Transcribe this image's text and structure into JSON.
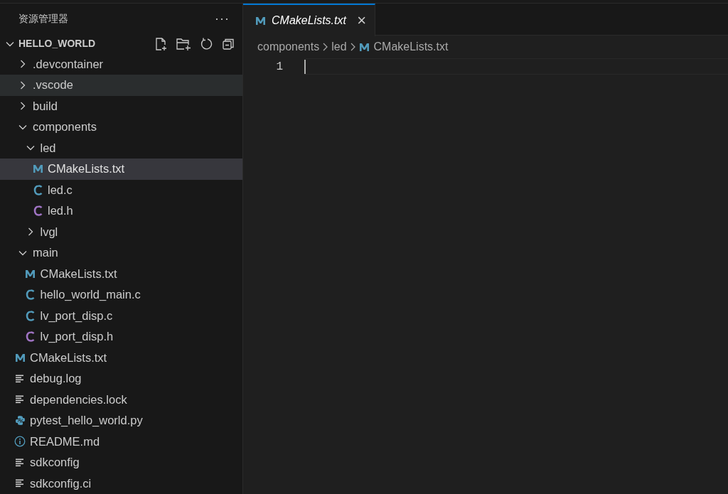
{
  "sidebar": {
    "title": "资源管理器",
    "more": "···",
    "workspace": {
      "label": "HELLO_WORLD",
      "expanded": true
    },
    "items": [
      {
        "label": ".devcontainer",
        "kind": "folder",
        "expanded": false,
        "selected": false,
        "hovered": false
      },
      {
        "label": ".vscode",
        "kind": "folder",
        "expanded": false,
        "selected": false,
        "hovered": true
      },
      {
        "label": "build",
        "kind": "folder",
        "expanded": false,
        "selected": false,
        "hovered": false
      },
      {
        "label": "components",
        "kind": "folder",
        "expanded": true,
        "selected": false,
        "hovered": false,
        "children": [
          {
            "label": "led",
            "kind": "folder",
            "expanded": true,
            "selected": false,
            "hovered": false,
            "children": [
              {
                "label": "CMakeLists.txt",
                "kind": "cmake",
                "selected": true,
                "hovered": false
              },
              {
                "label": "led.c",
                "kind": "c",
                "selected": false,
                "hovered": false
              },
              {
                "label": "led.h",
                "kind": "h",
                "selected": false,
                "hovered": false
              }
            ]
          },
          {
            "label": "lvgl",
            "kind": "folder",
            "expanded": false,
            "selected": false,
            "hovered": false
          }
        ]
      },
      {
        "label": "main",
        "kind": "folder",
        "expanded": true,
        "selected": false,
        "hovered": false,
        "children": [
          {
            "label": "CMakeLists.txt",
            "kind": "cmake",
            "selected": false,
            "hovered": false
          },
          {
            "label": "hello_world_main.c",
            "kind": "c",
            "selected": false,
            "hovered": false
          },
          {
            "label": "lv_port_disp.c",
            "kind": "c",
            "selected": false,
            "hovered": false
          },
          {
            "label": "lv_port_disp.h",
            "kind": "h",
            "selected": false,
            "hovered": false
          }
        ]
      },
      {
        "label": "CMakeLists.txt",
        "kind": "cmake",
        "selected": false,
        "hovered": false
      },
      {
        "label": "debug.log",
        "kind": "text",
        "selected": false,
        "hovered": false
      },
      {
        "label": "dependencies.lock",
        "kind": "text",
        "selected": false,
        "hovered": false
      },
      {
        "label": "pytest_hello_world.py",
        "kind": "python",
        "selected": false,
        "hovered": false
      },
      {
        "label": "README.md",
        "kind": "info",
        "selected": false,
        "hovered": false
      },
      {
        "label": "sdkconfig",
        "kind": "text",
        "selected": false,
        "hovered": false
      },
      {
        "label": "sdkconfig.ci",
        "kind": "text",
        "selected": false,
        "hovered": false
      }
    ]
  },
  "editor": {
    "tabs": [
      {
        "label": "CMakeLists.txt",
        "kind": "cmake",
        "selected": true,
        "close": "×"
      }
    ],
    "breadcrumbs": [
      {
        "label": "components",
        "kind": "folder"
      },
      {
        "label": "led",
        "kind": "folder"
      },
      {
        "label": "CMakeLists.txt",
        "kind": "cmake"
      }
    ],
    "lines": [
      {
        "number": "1"
      }
    ]
  }
}
